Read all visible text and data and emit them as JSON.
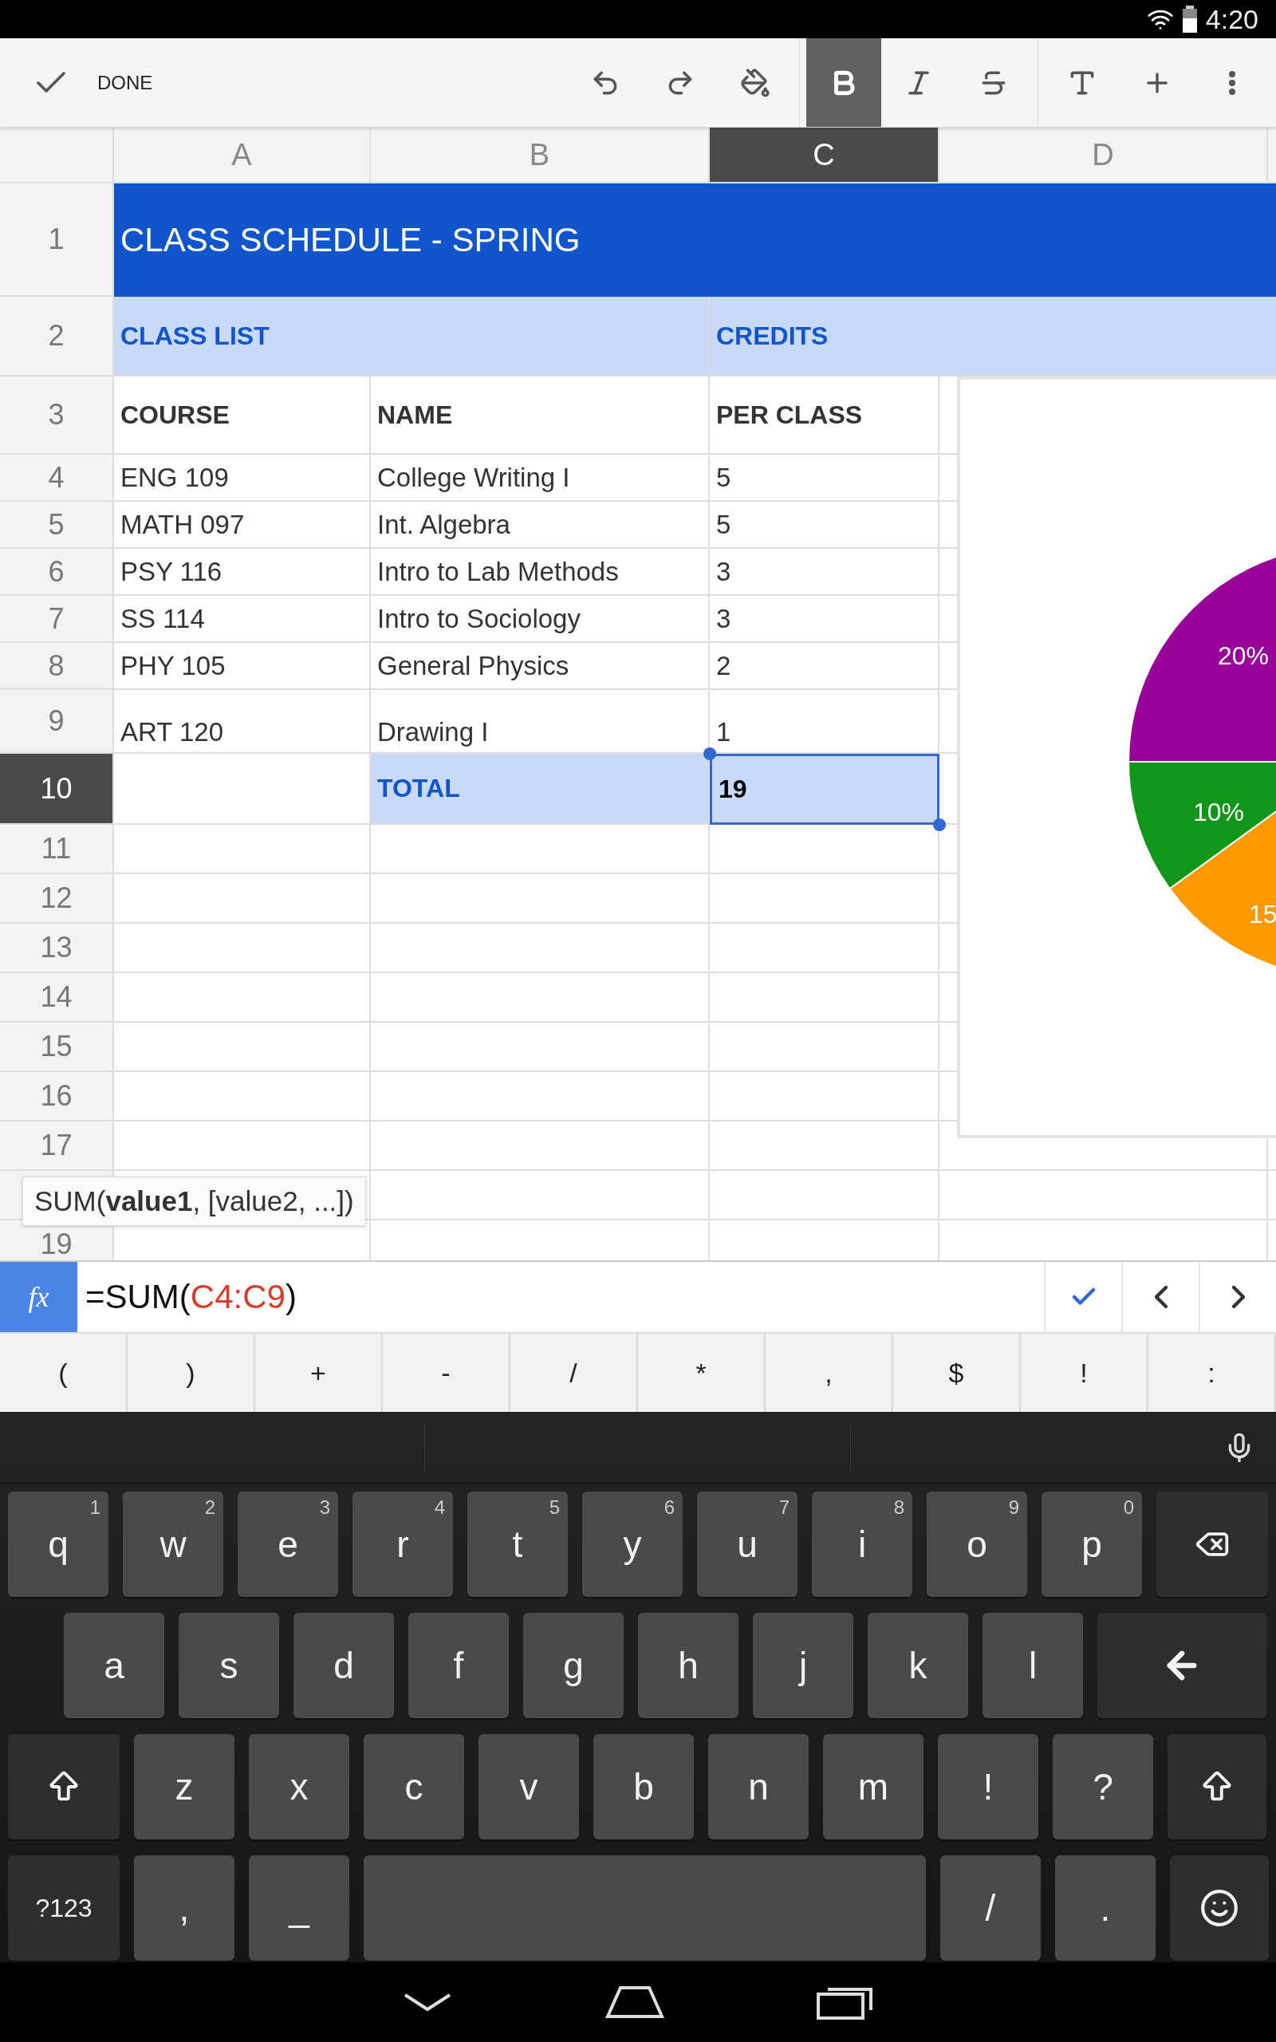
{
  "status_bar": {
    "time": "4:20"
  },
  "toolbar": {
    "done_label": "DONE",
    "actions": [
      {
        "kind": "undo"
      },
      {
        "kind": "redo"
      },
      {
        "kind": "fill"
      }
    ],
    "format": [
      {
        "kind": "bold",
        "selected": true
      },
      {
        "kind": "italic",
        "selected": false
      },
      {
        "kind": "strikethrough",
        "selected": false
      }
    ],
    "extras": [
      {
        "kind": "text-format"
      },
      {
        "kind": "insert"
      },
      {
        "kind": "more"
      }
    ]
  },
  "columns": [
    {
      "label": "A",
      "selected": false
    },
    {
      "label": "B",
      "selected": false
    },
    {
      "label": "C",
      "selected": true
    },
    {
      "label": "D",
      "selected": false
    }
  ],
  "rows": [
    {
      "kind": "title",
      "number": "1",
      "selected": false,
      "text": "CLASS SCHEDULE - SPRING"
    },
    {
      "kind": "section",
      "number": "2",
      "selected": false,
      "cells": [
        "CLASS LIST",
        "CREDITS"
      ]
    },
    {
      "kind": "header",
      "number": "3",
      "selected": false,
      "cells": [
        "COURSE",
        "NAME",
        "PER CLASS"
      ]
    },
    {
      "kind": "data",
      "number": "4",
      "selected": false,
      "cells": [
        "ENG 109",
        "College Writing I",
        "5"
      ]
    },
    {
      "kind": "data",
      "number": "5",
      "selected": false,
      "cells": [
        "MATH 097",
        "Int. Algebra",
        "5"
      ]
    },
    {
      "kind": "data",
      "number": "6",
      "selected": false,
      "cells": [
        "PSY 116",
        "Intro to Lab Methods",
        "3"
      ]
    },
    {
      "kind": "data",
      "number": "7",
      "selected": false,
      "cells": [
        "SS 114",
        "Intro to Sociology",
        "3"
      ]
    },
    {
      "kind": "data",
      "number": "8",
      "selected": false,
      "cells": [
        "PHY 105",
        "General Physics",
        "2"
      ]
    },
    {
      "kind": "tall",
      "number": "9",
      "selected": false,
      "cells": [
        "ART 120",
        "Drawing I",
        "1"
      ]
    },
    {
      "kind": "total",
      "number": "10",
      "selected": true,
      "label": "TOTAL",
      "value": "19"
    },
    {
      "kind": "empty",
      "number": "11",
      "selected": false
    },
    {
      "kind": "empty",
      "number": "12",
      "selected": false
    },
    {
      "kind": "empty",
      "number": "13",
      "selected": false
    },
    {
      "kind": "empty",
      "number": "14",
      "selected": false
    },
    {
      "kind": "empty",
      "number": "15",
      "selected": false
    },
    {
      "kind": "empty",
      "number": "16",
      "selected": false
    },
    {
      "kind": "empty",
      "number": "17",
      "selected": false
    },
    {
      "kind": "empty",
      "selected": false
    },
    {
      "kind": "empty",
      "number": "19",
      "selected": false
    }
  ],
  "pie_chart": {
    "slices": [
      {
        "label": "20%",
        "color": "#990099"
      },
      {
        "label": "10%",
        "color": "#109618"
      },
      {
        "label": "15",
        "color": "#ff9900"
      }
    ]
  },
  "tooltip": "SUM(**value1**, [value2, ...])",
  "formula_bar": {
    "fx_label": "fx",
    "prefix": "=SUM(",
    "range": "C4:C9",
    "suffix": ")"
  },
  "symbol_keys": [
    "(",
    ")",
    "+",
    "-",
    "/",
    "*",
    ",",
    "$",
    "!",
    ":"
  ],
  "keyboard": [
    [
      {
        "kind": "char",
        "label": "q",
        "hint": "1"
      },
      {
        "kind": "char",
        "label": "w",
        "hint": "2"
      },
      {
        "kind": "char",
        "label": "e",
        "hint": "3"
      },
      {
        "kind": "char",
        "label": "r",
        "hint": "4"
      },
      {
        "kind": "char",
        "label": "t",
        "hint": "5"
      },
      {
        "kind": "char",
        "label": "y",
        "hint": "6"
      },
      {
        "kind": "char",
        "label": "u",
        "hint": "7"
      },
      {
        "kind": "char",
        "label": "i",
        "hint": "8"
      },
      {
        "kind": "char",
        "label": "o",
        "hint": "9"
      },
      {
        "kind": "char",
        "label": "p",
        "hint": "0"
      },
      {
        "kind": "backspace"
      }
    ],
    [
      {
        "kind": "char",
        "label": "a"
      },
      {
        "kind": "char",
        "label": "s"
      },
      {
        "kind": "char",
        "label": "d"
      },
      {
        "kind": "char",
        "label": "f"
      },
      {
        "kind": "char",
        "label": "g"
      },
      {
        "kind": "char",
        "label": "h"
      },
      {
        "kind": "char",
        "label": "j"
      },
      {
        "kind": "char",
        "label": "k"
      },
      {
        "kind": "char",
        "label": "l"
      },
      {
        "kind": "enter"
      }
    ],
    [
      {
        "kind": "shift"
      },
      {
        "kind": "char",
        "label": "z"
      },
      {
        "kind": "char",
        "label": "x"
      },
      {
        "kind": "char",
        "label": "c"
      },
      {
        "kind": "char",
        "label": "v"
      },
      {
        "kind": "char",
        "label": "b"
      },
      {
        "kind": "char",
        "label": "n"
      },
      {
        "kind": "char",
        "label": "m"
      },
      {
        "kind": "char",
        "label": "!"
      },
      {
        "kind": "char",
        "label": "?"
      },
      {
        "kind": "shift"
      }
    ],
    [
      {
        "kind": "mode",
        "label": "?123"
      },
      {
        "kind": "char",
        "label": ","
      },
      {
        "kind": "char",
        "label": "_"
      },
      {
        "kind": "space"
      },
      {
        "kind": "char",
        "label": "/"
      },
      {
        "kind": "char",
        "label": "."
      },
      {
        "kind": "emoji"
      }
    ]
  ]
}
